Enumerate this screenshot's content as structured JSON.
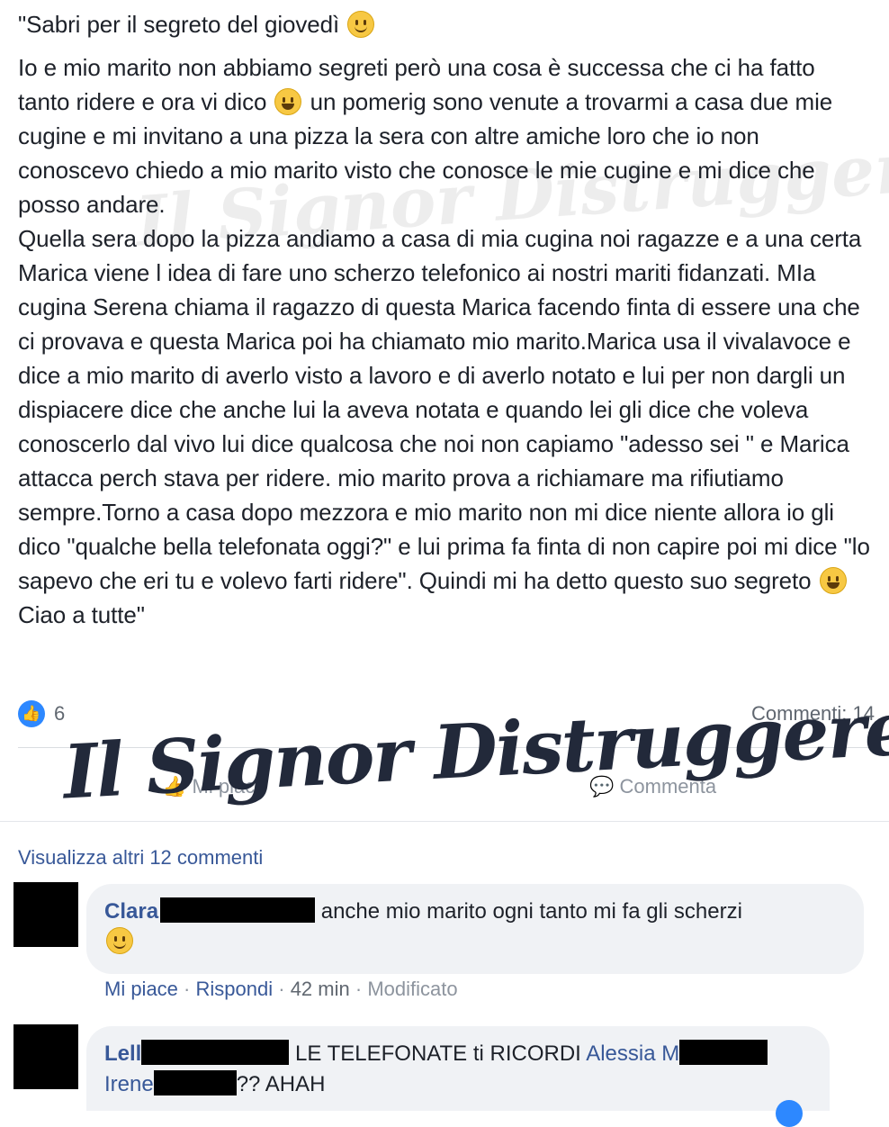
{
  "post": {
    "title": "\"Sabri per il segreto del giovedì",
    "paragraph1_a": "Io e mio marito non abbiamo segreti però una cosa è successa che ci ha fatto tanto ridere e ora vi dico",
    "paragraph1_b": "un pomerig sono venute a trovarmi a casa due mie cugine e mi invitano a una pizza la sera con altre amiche loro che io non conoscevo chiedo a mio marito visto che conosce le mie cugine e mi dice che posso andare.",
    "paragraph2_a": "Quella sera dopo la pizza andiamo a casa di mia cugina noi ragazze e a una certa Marica viene l idea di fare uno scherzo telefonico ai nostri mariti fidanzati. MIa cugina Serena chiama il ragazzo di questa Marica facendo finta di essere una che ci provava e questa Marica poi ha chiamato mio marito.Marica usa il vivalavoce e dice a mio marito di averlo visto a lavoro e di averlo notato e lui per non dargli un dispiacere dice che anche lui la aveva notata e quando lei gli dice che voleva conoscerlo dal vivo lui dice qualcosa che noi non capiamo \"adesso sei \" e Marica attacca perch stava per ridere. mio marito prova a richiamare ma rifiutiamo sempre.Torno a casa dopo mezzora e mio marito non mi dice niente allora io gli dico \"qualche bella telefonata oggi?\" e lui prima fa finta di non capire poi mi dice \"lo sapevo che eri tu e volevo farti ridere\". Quindi mi ha detto questo suo segreto",
    "paragraph2_b": "Ciao a tutte\""
  },
  "reactions": {
    "like_count": "6",
    "comments_label": "Commenti: 14"
  },
  "actions": {
    "like_label": "Mi piace",
    "comment_label": "Commenta"
  },
  "watermark": {
    "text": "Il Signor Distruggere"
  },
  "comments": {
    "view_more": "Visualizza altri 12 commenti",
    "items": [
      {
        "author": "Clara",
        "text": "anche mio marito ogni tanto mi fa gli scherzi",
        "like": "Mi piace",
        "reply": "Rispondi",
        "time": "42 min",
        "edited": "Modificato"
      },
      {
        "author": "Lell",
        "text": "LE TELEFONATE ti RICORDI",
        "mention1": "Alessia M",
        "mention2": "Irene",
        "tail": "?? AHAH"
      }
    ]
  },
  "colors": {
    "link": "#385898",
    "like_blue": "#2d88ff",
    "bubble": "#f0f2f5"
  }
}
